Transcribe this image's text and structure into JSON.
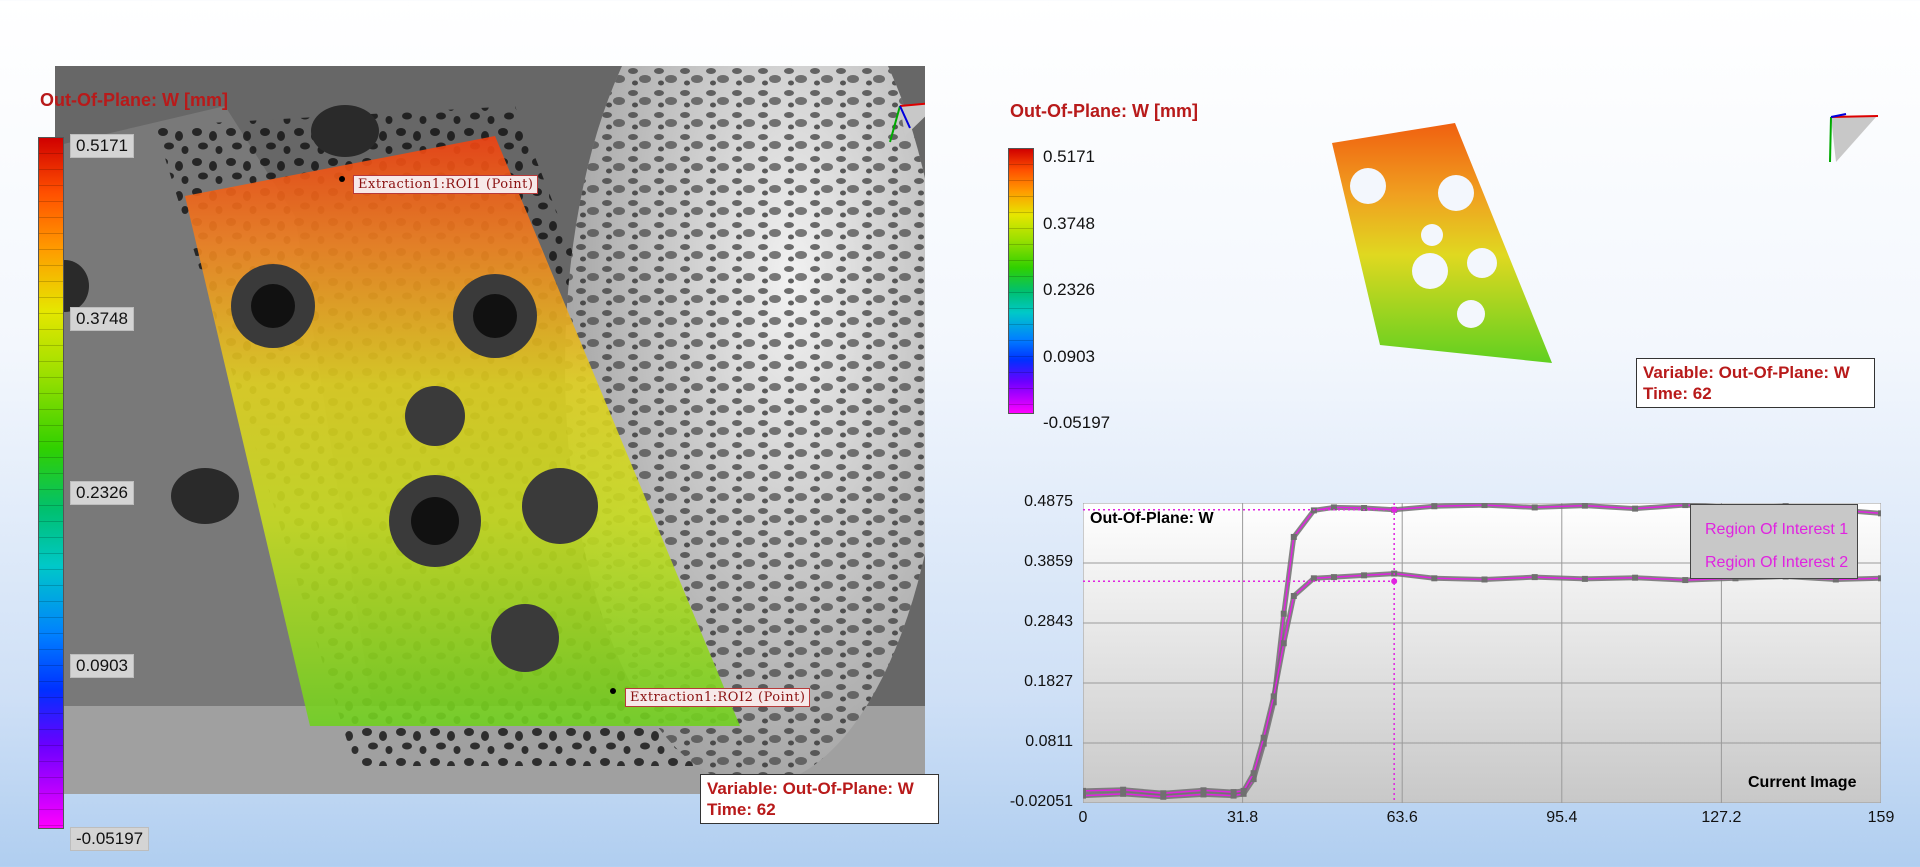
{
  "left_view": {
    "colorbar": {
      "title": "Out-Of-Plane: W [mm]",
      "ticks": [
        "0.5171",
        "0.3748",
        "0.2326",
        "0.0903",
        "-0.05197"
      ]
    },
    "roi_labels": [
      "Extraction1:ROI1 (Point)",
      "Extraction1:ROI2 (Point)"
    ],
    "info": {
      "variable": "Variable: Out-Of-Plane: W",
      "time": "Time: 62"
    }
  },
  "right_view": {
    "colorbar": {
      "title": "Out-Of-Plane: W [mm]",
      "ticks": [
        "0.5171",
        "0.3748",
        "0.2326",
        "0.0903",
        "-0.05197"
      ]
    },
    "info": {
      "variable": "Variable: Out-Of-Plane: W",
      "time": "Time: 62"
    }
  },
  "colors": {
    "accent_red": "#b81a1a",
    "series_magenta": "#e023e0",
    "marker_gray": "#707070"
  },
  "chart_data": {
    "type": "line",
    "title": "Out-Of-Plane: W",
    "annotation": "Current Image",
    "x_ticks": [
      "0",
      "31.8",
      "63.6",
      "95.4",
      "127.2",
      "159"
    ],
    "y_ticks": [
      "0.4875",
      "0.3859",
      "0.2843",
      "0.1827",
      "0.0811",
      "-0.02051"
    ],
    "xlim": [
      0,
      159
    ],
    "ylim": [
      -0.02051,
      0.4875
    ],
    "current_x": 62,
    "legend_position": "top-right",
    "series": [
      {
        "name": "Region Of Interest 1",
        "x": [
          0,
          8,
          16,
          24,
          30,
          32,
          34,
          36,
          38,
          40,
          42,
          46,
          50,
          56,
          62,
          70,
          80,
          90,
          100,
          110,
          120,
          130,
          140,
          150,
          159
        ],
        "y": [
          -0.008,
          -0.005,
          -0.01,
          -0.006,
          -0.008,
          -0.005,
          0.02,
          0.08,
          0.15,
          0.3,
          0.43,
          0.475,
          0.48,
          0.479,
          0.476,
          0.482,
          0.484,
          0.48,
          0.483,
          0.478,
          0.484,
          0.48,
          0.482,
          0.476,
          0.47
        ],
        "current_y": 0.476
      },
      {
        "name": "Region Of Interest 2",
        "x": [
          0,
          8,
          16,
          24,
          30,
          32,
          34,
          36,
          38,
          40,
          42,
          46,
          50,
          56,
          62,
          70,
          80,
          90,
          100,
          110,
          120,
          130,
          140,
          150,
          159
        ],
        "y": [
          0.0,
          0.002,
          -0.004,
          0.001,
          -0.002,
          0.0,
          0.03,
          0.09,
          0.16,
          0.25,
          0.33,
          0.36,
          0.362,
          0.365,
          0.368,
          0.36,
          0.358,
          0.362,
          0.359,
          0.361,
          0.357,
          0.36,
          0.363,
          0.358,
          0.36
        ],
        "current_y": 0.355
      }
    ]
  }
}
